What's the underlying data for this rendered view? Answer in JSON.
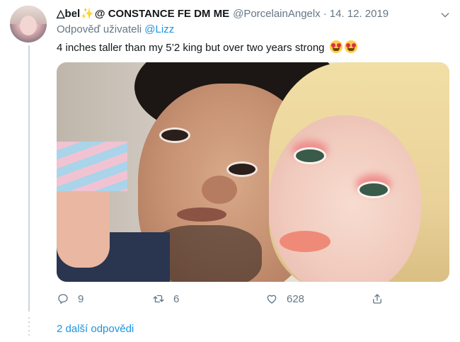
{
  "tweet": {
    "author_name_part1": "△bel",
    "author_sparkle": "✨",
    "author_name_part2": "@ CONSTANCE FE DM ME",
    "handle": "@PorcelainAngelx",
    "separator": "·",
    "date": "14. 12. 2019",
    "reply_prefix": "Odpověď uživateli",
    "reply_mention": "@Lizz",
    "text": "4 inches taller than my 5’2 king but over two years strong",
    "emojis": [
      "heart-eyes-emoji",
      "heart-eyes-emoji"
    ]
  },
  "actions": {
    "replies": "9",
    "retweets": "6",
    "likes": "628"
  },
  "more_replies_label": "2 další odpovědi",
  "colors": {
    "link": "#1b95e0",
    "secondary_text": "#657786",
    "primary_text": "#14171a",
    "thread_line": "#ccd6dd"
  }
}
